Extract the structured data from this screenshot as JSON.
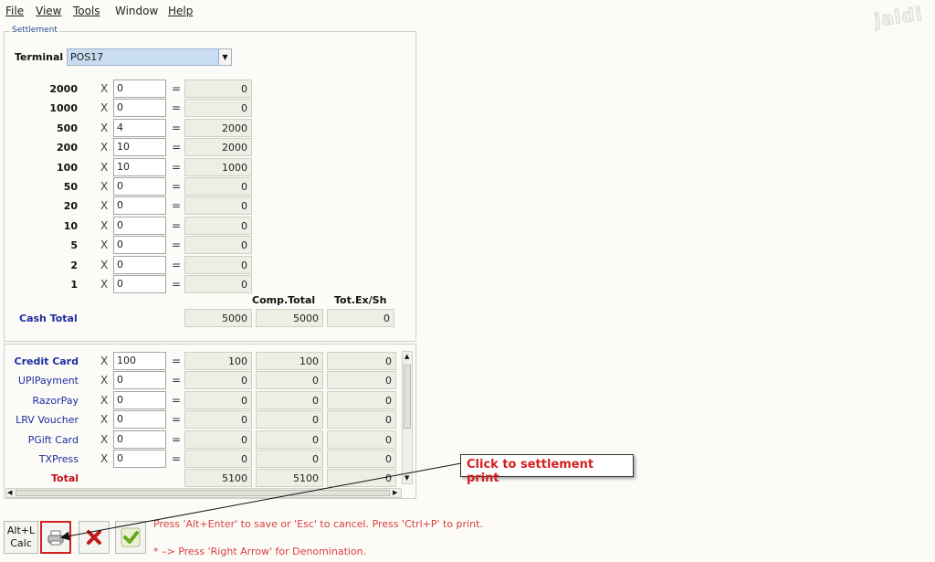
{
  "menu": {
    "file": "File",
    "view": "View",
    "tools": "Tools",
    "window": "Window",
    "help": "Help"
  },
  "logo_text": "jaldi",
  "settlement": {
    "legend": "Settlement",
    "terminal_label": "Terminal",
    "terminal_value": "POS17",
    "denominations": [
      {
        "label": "2000",
        "qty": "0",
        "amount": "0"
      },
      {
        "label": "1000",
        "qty": "0",
        "amount": "0"
      },
      {
        "label": "500",
        "qty": "4",
        "amount": "2000"
      },
      {
        "label": "200",
        "qty": "10",
        "amount": "2000"
      },
      {
        "label": "100",
        "qty": "10",
        "amount": "1000"
      },
      {
        "label": "50",
        "qty": "0",
        "amount": "0"
      },
      {
        "label": "20",
        "qty": "0",
        "amount": "0"
      },
      {
        "label": "10",
        "qty": "0",
        "amount": "0"
      },
      {
        "label": "5",
        "qty": "0",
        "amount": "0"
      },
      {
        "label": "2",
        "qty": "0",
        "amount": "0"
      },
      {
        "label": "1",
        "qty": "0",
        "amount": "0"
      }
    ],
    "comp_total_header": "Comp.Total",
    "tot_ex_header": "Tot.Ex/Sh",
    "cash_total_label": "Cash Total",
    "cash_total": "5000",
    "cash_comp_total": "5000",
    "cash_tot_ex": "0"
  },
  "payments": {
    "rows": [
      {
        "label": "Credit Card",
        "qty": "100",
        "amount": "100",
        "comp": "100",
        "ex": "0"
      },
      {
        "label": "UPIPayment",
        "qty": "0",
        "amount": "0",
        "comp": "0",
        "ex": "0"
      },
      {
        "label": "RazorPay",
        "qty": "0",
        "amount": "0",
        "comp": "0",
        "ex": "0"
      },
      {
        "label": "LRV Voucher",
        "qty": "0",
        "amount": "0",
        "comp": "0",
        "ex": "0"
      },
      {
        "label": "PGift Card",
        "qty": "0",
        "amount": "0",
        "comp": "0",
        "ex": "0"
      },
      {
        "label": "TXPress",
        "qty": "0",
        "amount": "0",
        "comp": "0",
        "ex": "0"
      }
    ],
    "total_label": "Total",
    "total_amount": "5100",
    "total_comp": "5100",
    "total_ex": "0"
  },
  "symbols": {
    "x": "X",
    "eq": "="
  },
  "buttons": {
    "calc_line1": "Alt+L",
    "calc_line2": "Calc",
    "print_icon": "printer-icon",
    "cancel_icon": "close-icon",
    "ok_icon": "check-icon"
  },
  "hints": {
    "save_hint": "Press 'Alt+Enter' to save or 'Esc' to cancel. Press 'Ctrl+P' to print.",
    "denomination_hint": "* –> Press 'Right Arrow' for Denomination."
  },
  "callout_text": "Click to settlement print",
  "colors": {
    "accent_blue": "#1d2fa0",
    "total_red": "#c0101a",
    "hint_red": "#d84040",
    "callout_red": "#d42020"
  }
}
